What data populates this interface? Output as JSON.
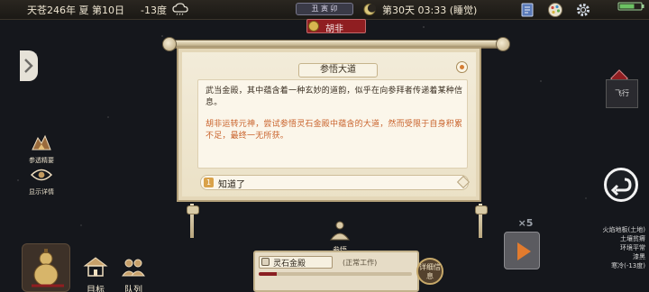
{
  "topbar": {
    "date": "天苍246年 夏 第10日",
    "temperature": "-13度",
    "day_time": "第30天 03:33 (睡觉)"
  },
  "date_banner": {
    "label": "丑 寅 卯"
  },
  "character_tag": {
    "name": "胡非"
  },
  "side_buttons": [
    {
      "label": "参透精要"
    },
    {
      "label": "显示详情"
    }
  ],
  "bottom_nav": [
    {
      "label": "目标"
    },
    {
      "label": "队列"
    }
  ],
  "dialog": {
    "title": "参悟大道",
    "paragraph_1": "武当金殿，其中蕴含着一种玄妙的道韵，似乎在向参拜者传递着某种信息。",
    "paragraph_2": "胡非运转元神，尝试参悟灵石金殿中蕴含的大道，然而受限于自身积累不足，最终一无所获。",
    "option_number": "1",
    "option_text": "知道了"
  },
  "ponder": {
    "label": "参悟"
  },
  "work": {
    "name": "灵石金殿",
    "status": "(正常工作)",
    "progress": 0.12,
    "detail_label": "详细信息"
  },
  "right": {
    "hanging_label": "飞行",
    "speed": "×5",
    "env": [
      "火焰地板(土地)",
      "土壤贫瘠",
      "环境平常",
      "漆黑",
      "寒冷(-13度)"
    ]
  },
  "colors": {
    "accent_red": "#8f1e21",
    "event_orange": "#c9632c",
    "scroll_parchment": "#f3ecda",
    "progress_fill": "#8a1f22"
  }
}
